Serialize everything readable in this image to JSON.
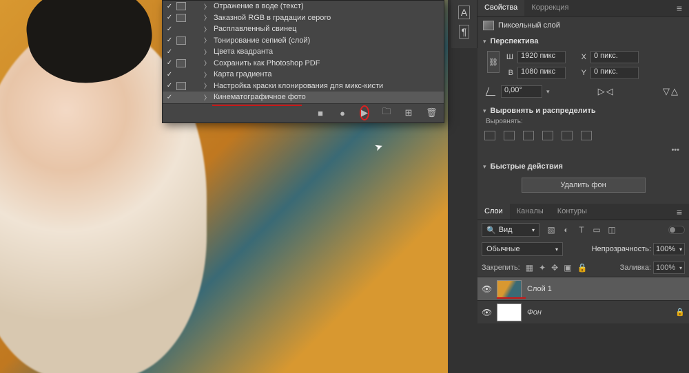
{
  "actions": {
    "items": [
      {
        "label": "Отражение в воде (текст)",
        "box": true
      },
      {
        "label": "Заказной RGB в градации серого",
        "box": true
      },
      {
        "label": "Расплавленный свинец",
        "box": false
      },
      {
        "label": "Тонирование сепией (слой)",
        "box": true
      },
      {
        "label": "Цвета квадранта",
        "box": false
      },
      {
        "label": "Сохранить как Photoshop PDF",
        "box": true
      },
      {
        "label": "Карта градиента",
        "box": false
      },
      {
        "label": "Настройка краски клонирования для микс-кисти",
        "box": true
      },
      {
        "label": "Кинематографичное фото",
        "box": false,
        "selected": true
      }
    ]
  },
  "properties": {
    "tab_props": "Свойства",
    "tab_adjust": "Коррекция",
    "layer_type": "Пиксельный слой",
    "perspective": "Перспектива",
    "W": "Ш",
    "H": "В",
    "X": "X",
    "Y": "Y",
    "w_val": "1920 пикс",
    "h_val": "1080 пикс",
    "x_val": "0 пикс.",
    "y_val": "0 пикс.",
    "angle": "0,00°",
    "align_head": "Выровнять и распределить",
    "align_lbl": "Выровнять:",
    "quick_head": "Быстрые действия",
    "del_bg": "Удалить фон"
  },
  "layers": {
    "tab_layers": "Слои",
    "tab_channels": "Каналы",
    "tab_paths": "Контуры",
    "filter_kind": "Вид",
    "blend_mode": "Обычные",
    "opacity_lbl": "Непрозрачность:",
    "opacity_val": "100%",
    "lock_lbl": "Закрепить:",
    "fill_lbl": "Заливка:",
    "fill_val": "100%",
    "layer1": "Слой 1",
    "bg": "Фон"
  }
}
